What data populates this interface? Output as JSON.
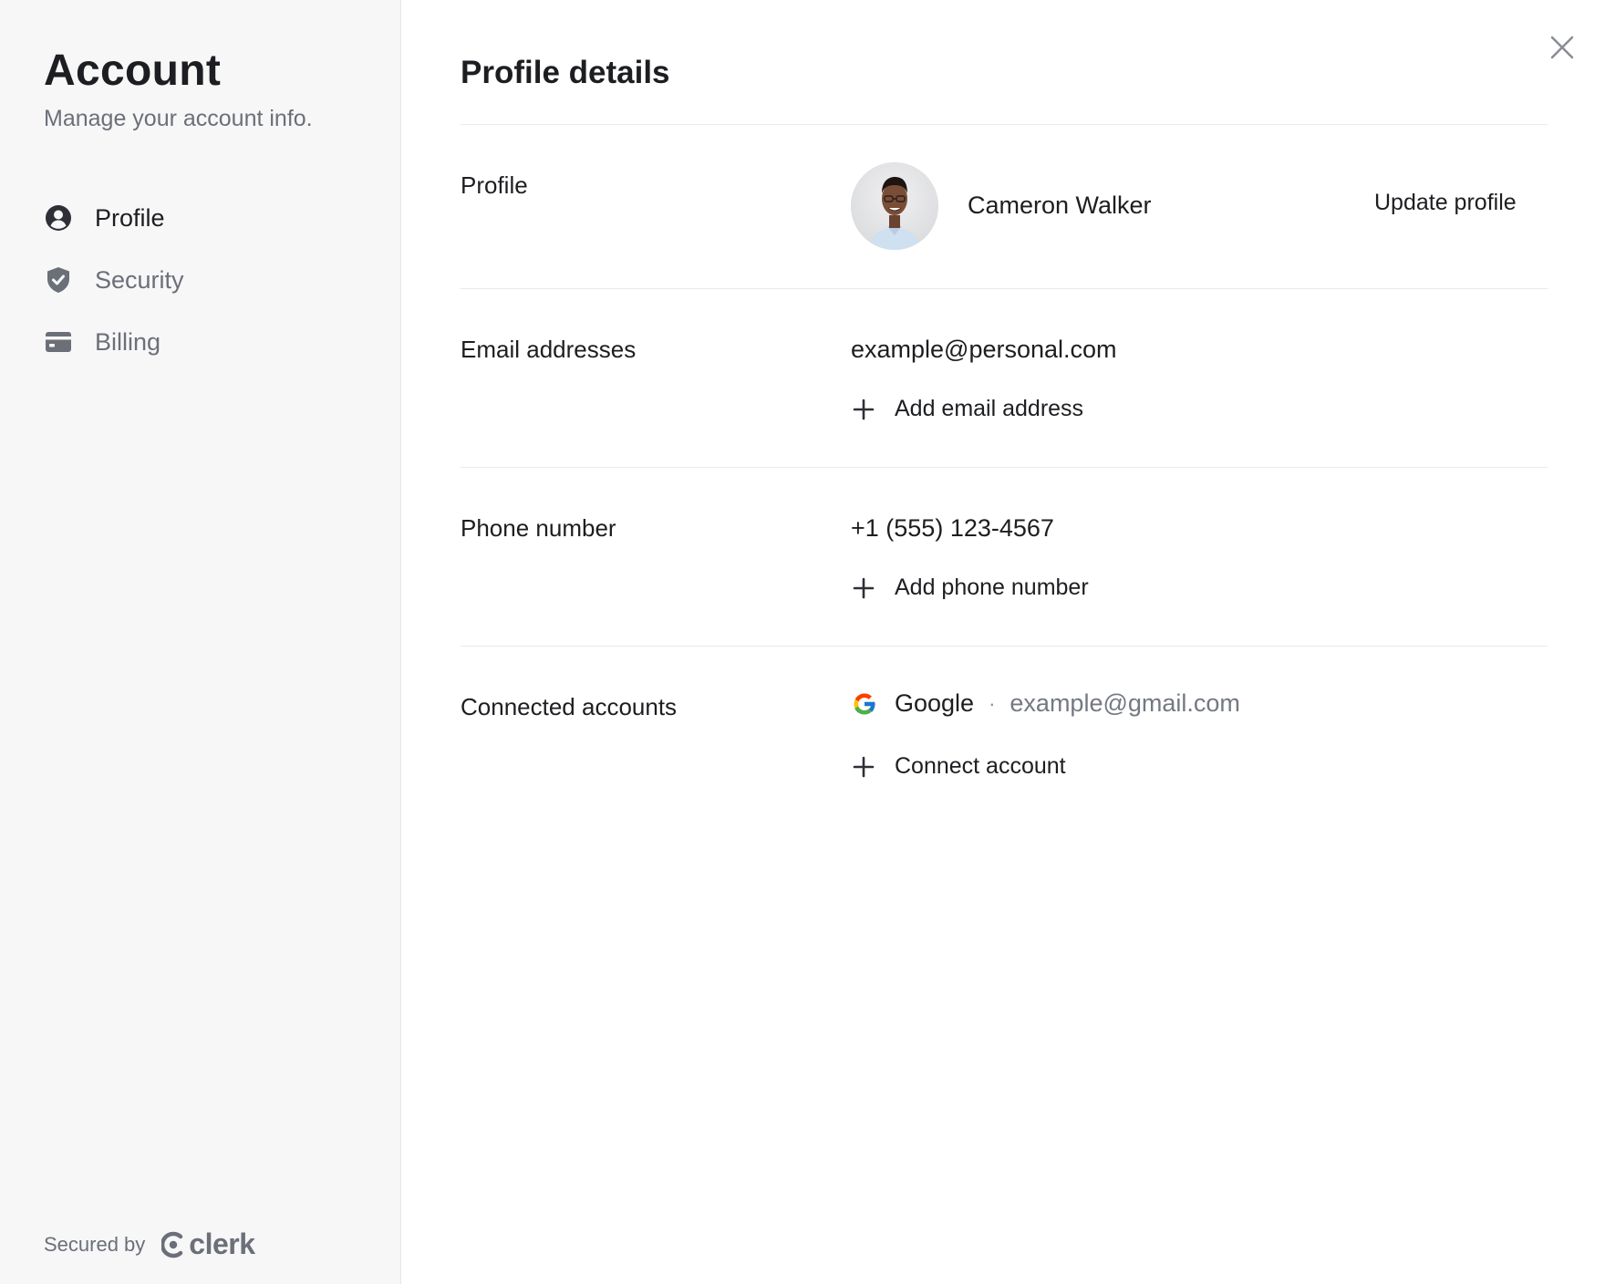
{
  "sidebar": {
    "title": "Account",
    "subtitle": "Manage your account info.",
    "items": [
      {
        "label": "Profile",
        "icon": "user-circle-icon",
        "active": true
      },
      {
        "label": "Security",
        "icon": "shield-check-icon",
        "active": false
      },
      {
        "label": "Billing",
        "icon": "credit-card-icon",
        "active": false
      }
    ],
    "secured_by": "Secured by",
    "brand": "clerk"
  },
  "main": {
    "title": "Profile details",
    "profile": {
      "label": "Profile",
      "name": "Cameron Walker",
      "update_label": "Update profile"
    },
    "email": {
      "label": "Email addresses",
      "value": "example@personal.com",
      "add_label": "Add email address"
    },
    "phone": {
      "label": "Phone number",
      "value": "+1 (555) 123-4567",
      "add_label": "Add phone number"
    },
    "connected": {
      "label": "Connected accounts",
      "provider": "Google",
      "separator": "·",
      "provider_email": "example@gmail.com",
      "add_label": "Connect account"
    }
  },
  "colors": {
    "sidebar_bg": "#f7f7f8",
    "text_primary": "#1d1e21",
    "text_muted": "#6b6f78",
    "divider": "#e9e9ec"
  }
}
